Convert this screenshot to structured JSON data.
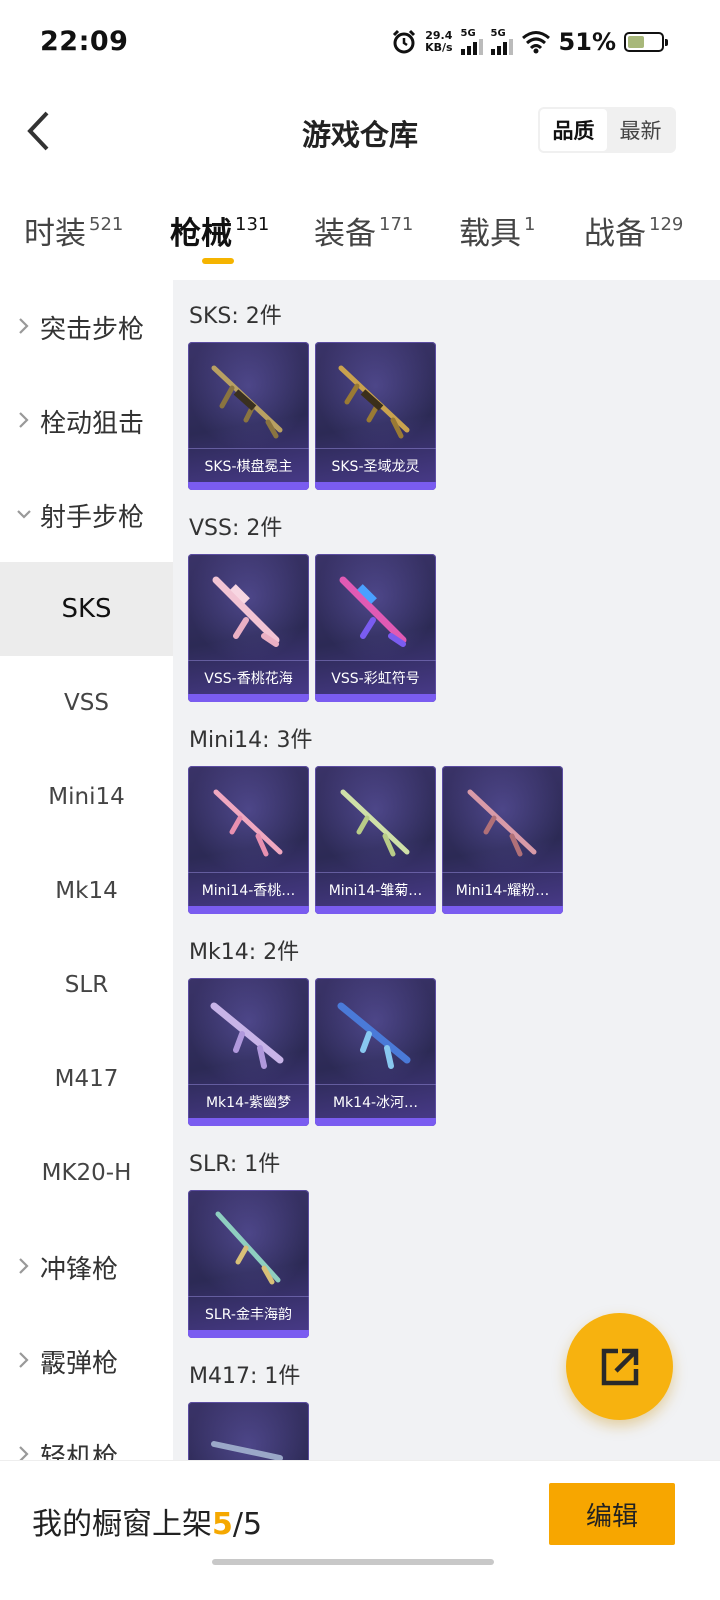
{
  "status": {
    "time": "22:09",
    "net_speed_value": "29.4",
    "net_speed_unit": "KB/s",
    "signal1_tag": "5G",
    "signal2_tag": "5G",
    "battery_text": "51%",
    "battery_level": 0.51,
    "icons": [
      "alarm-icon",
      "signal-icon",
      "wifi-icon",
      "battery-icon"
    ]
  },
  "header": {
    "title": "游戏仓库",
    "sort_options": [
      "品质",
      "最新"
    ],
    "sort_selected": "品质"
  },
  "tabs": [
    {
      "label": "时装",
      "count": "521"
    },
    {
      "label": "枪械",
      "count": "131",
      "active": true
    },
    {
      "label": "装备",
      "count": "171"
    },
    {
      "label": "载具",
      "count": "1"
    },
    {
      "label": "战备",
      "count": "129"
    }
  ],
  "sidebar": {
    "categories": [
      {
        "label": "突击步枪",
        "expanded": false
      },
      {
        "label": "栓动狙击",
        "expanded": false
      },
      {
        "label": "射手步枪",
        "expanded": true
      },
      {
        "label": "冲锋枪",
        "expanded": false
      },
      {
        "label": "霰弹枪",
        "expanded": false
      },
      {
        "label": "轻机枪",
        "expanded": false
      }
    ],
    "subitems": [
      "SKS",
      "VSS",
      "Mini14",
      "Mk14",
      "SLR",
      "M417",
      "MK20-H"
    ],
    "selected_sub": "SKS"
  },
  "groups": [
    {
      "title": "SKS: 2件",
      "items": [
        "SKS-棋盘冕主",
        "SKS-圣域龙灵"
      ]
    },
    {
      "title": "VSS: 2件",
      "items": [
        "VSS-香桃花海",
        "VSS-彩虹符号"
      ]
    },
    {
      "title": "Mini14: 3件",
      "items": [
        "Mini14-香桃…",
        "Mini14-雏菊…",
        "Mini14-耀粉…"
      ]
    },
    {
      "title": "Mk14: 2件",
      "items": [
        "Mk14-紫幽梦",
        "Mk14-冰河…"
      ]
    },
    {
      "title": "SLR: 1件",
      "items": [
        "SLR-金丰海韵"
      ]
    },
    {
      "title": "M417: 1件",
      "items": [
        ""
      ]
    }
  ],
  "bottom": {
    "label_prefix": "我的橱窗上架",
    "count_highlight": "5",
    "count_rest": "/5",
    "edit_label": "编辑"
  },
  "colors": {
    "accent": "#f5b400",
    "card_bg": "#2c2a55",
    "card_bar": "#7a5cf0"
  }
}
